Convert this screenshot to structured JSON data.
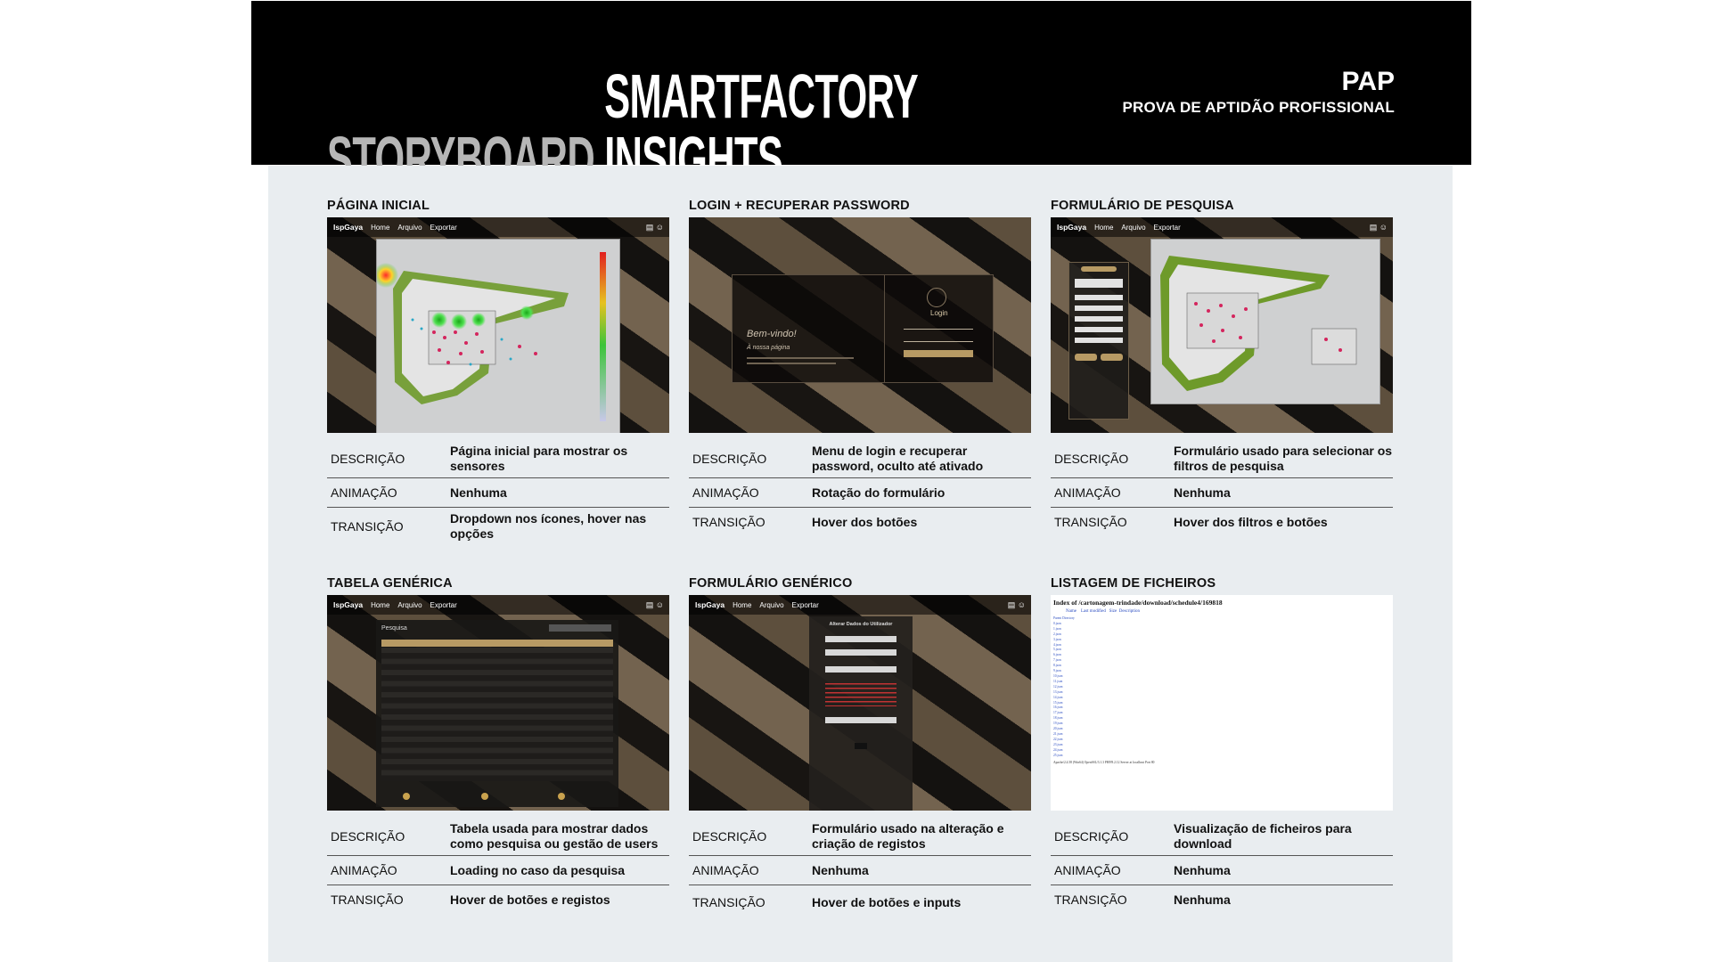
{
  "header": {
    "brand_storyboard": "STORYBOARD",
    "brand_name": "SMARTFACTORY INSIGHTS",
    "pap_title": "PAP",
    "pap_subtitle": "PROVA DE APTIDÃO PROFISSIONAL"
  },
  "labels": {
    "descricao": "DESCRIÇÃO",
    "animacao": "ANIMAÇÃO",
    "transicao": "TRANSIÇÃO"
  },
  "mock_app": {
    "logo": "IspGaya",
    "nav": [
      "Home",
      "Arquivo",
      "Exportar"
    ],
    "icons": [
      "printer-icon",
      "user-icon"
    ]
  },
  "mock_login": {
    "welcome": "Bem-vindo!",
    "subtitle": "À nossa página",
    "login": "Login"
  },
  "mock_table": {
    "title": "Pesquisa"
  },
  "mock_form": {
    "title": "Alterar Dados do Utilizador"
  },
  "mock_files": {
    "heading": "Index of /cartonagem-trindade/download/schedule4/169818",
    "links": [
      "Name",
      "Last modified",
      "Size",
      "Description"
    ],
    "parent": "Parent Directory",
    "footer": "Apache/2.4.58 (Win64) OpenSSL/3.1.3 PHP/8.2.12 Server at localhost Port 80",
    "entries": [
      "0.json",
      "1.json",
      "2.json",
      "3.json",
      "4.json",
      "5.json",
      "6.json",
      "7.json",
      "8.json",
      "9.json",
      "10.json",
      "11.json",
      "12.json",
      "13.json",
      "14.json",
      "15.json",
      "16.json",
      "17.json",
      "18.json",
      "19.json",
      "20.json",
      "21.json",
      "22.json",
      "23.json",
      "24.json",
      "25.json"
    ]
  },
  "cards": [
    {
      "title": "PÁGINA INICIAL",
      "descricao": "Página inicial para mostrar os sensores",
      "animacao": "Nenhuma",
      "transicao": "Dropdown nos ícones, hover nas opções"
    },
    {
      "title": "LOGIN + RECUPERAR PASSWORD",
      "descricao": "Menu de login e recuperar password, oculto até ativado",
      "animacao": "Rotação do formulário",
      "transicao": "Hover dos botões"
    },
    {
      "title": "FORMULÁRIO DE PESQUISA",
      "descricao": "Formulário usado para selecionar os filtros de pesquisa",
      "animacao": "Nenhuma",
      "transicao": "Hover dos filtros e botões"
    },
    {
      "title": "TABELA GENÉRICA",
      "descricao": "Tabela usada para mostrar dados como pesquisa ou gestão de users",
      "animacao": "Loading no caso da pesquisa",
      "transicao": "Hover de botões e registos"
    },
    {
      "title": "FORMULÁRIO GENÉRICO",
      "descricao": "Formulário usado na alteração e criação de registos",
      "animacao": "Nenhuma",
      "transicao": "Hover de botões e inputs"
    },
    {
      "title": "LISTAGEM DE FICHEIROS",
      "descricao": "Visualização de ficheiros para download",
      "animacao": "Nenhuma",
      "transicao": "Nenhuma"
    }
  ]
}
